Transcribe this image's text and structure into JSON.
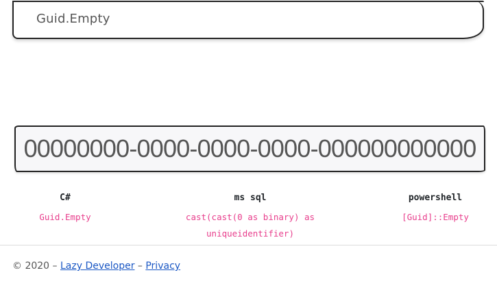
{
  "header": {
    "title": "Guid.Empty"
  },
  "guid": {
    "value": "00000000-0000-0000-0000-000000000000"
  },
  "examples": [
    {
      "language": "C#",
      "code": "Guid.Empty"
    },
    {
      "language": "ms sql",
      "code_line1": "cast(cast(0 as binary) as",
      "code_line2": "uniqueidentifier)"
    },
    {
      "language": "powershell",
      "code": "[Guid]::Empty"
    }
  ],
  "footer": {
    "copyright": "© 2020 –",
    "separator": "–",
    "link1": "Lazy Developer",
    "link2": "Privacy"
  },
  "colors": {
    "code": "#e83e8c",
    "link": "#1a57c4"
  }
}
